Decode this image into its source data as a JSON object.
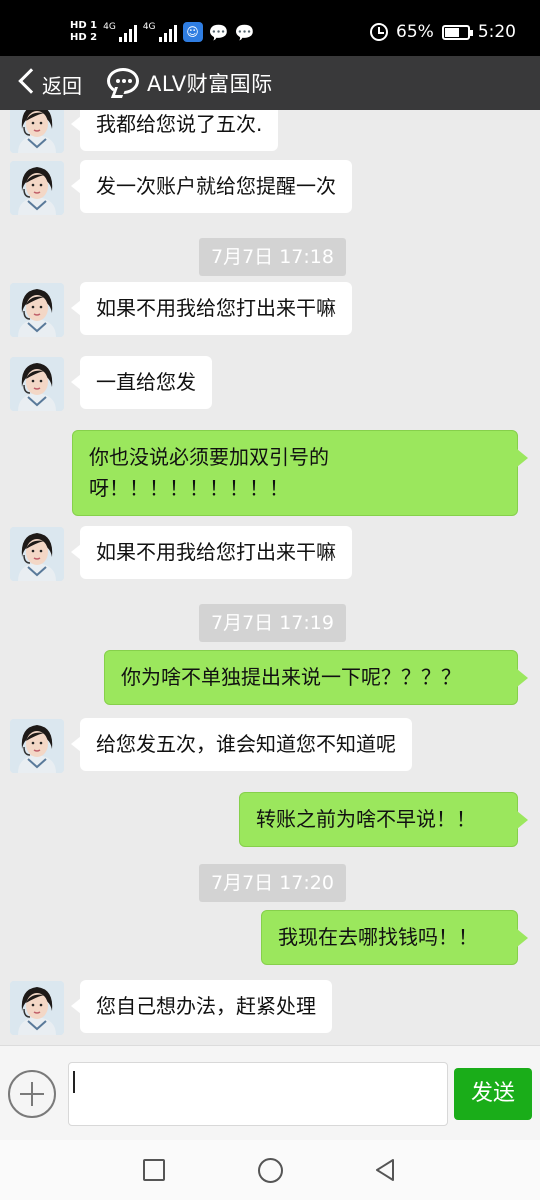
{
  "status_bar": {
    "hd1": "HD 1",
    "hd2": "HD 2",
    "network": "4G",
    "battery_percent": "65%",
    "battery_level": 0.65,
    "time": "5:20",
    "icons": [
      "hd-icon",
      "signal-icon",
      "signal-icon",
      "app-icon",
      "message-icon",
      "wechat-icon",
      "alarm-icon",
      "battery-icon"
    ]
  },
  "header": {
    "back_label": "返回",
    "title": "ALV财富国际"
  },
  "messages": [
    {
      "type": "in",
      "text": "我都给您说了五次."
    },
    {
      "type": "in",
      "text": "发一次账户就给您提醒一次"
    },
    {
      "type": "time",
      "text": "7月7日 17:18"
    },
    {
      "type": "in",
      "text": "如果不用我给您打出来干嘛"
    },
    {
      "type": "in",
      "text": "一直给您发"
    },
    {
      "type": "out",
      "text": "你也没说必须要加双引号的\n呀！！！！！！！！！"
    },
    {
      "type": "in",
      "text": "如果不用我给您打出来干嘛"
    },
    {
      "type": "time",
      "text": "7月7日 17:19"
    },
    {
      "type": "out",
      "text": "你为啥不单独提出来说一下呢？？？？"
    },
    {
      "type": "in",
      "text": "给您发五次，谁会知道您不知道呢"
    },
    {
      "type": "out",
      "text": "转账之前为啥不早说！！"
    },
    {
      "type": "time",
      "text": "7月7日 17:20"
    },
    {
      "type": "out",
      "text": "我现在去哪找钱吗！！"
    },
    {
      "type": "in",
      "text": "您自己想办法，赶紧处理"
    }
  ],
  "input": {
    "value": "",
    "send_label": "发送"
  },
  "colors": {
    "header_bg": "#39393a",
    "chat_bg": "#ebebeb",
    "outgoing_bubble": "#9be75d",
    "incoming_bubble": "#ffffff",
    "send_button": "#1aad19"
  }
}
